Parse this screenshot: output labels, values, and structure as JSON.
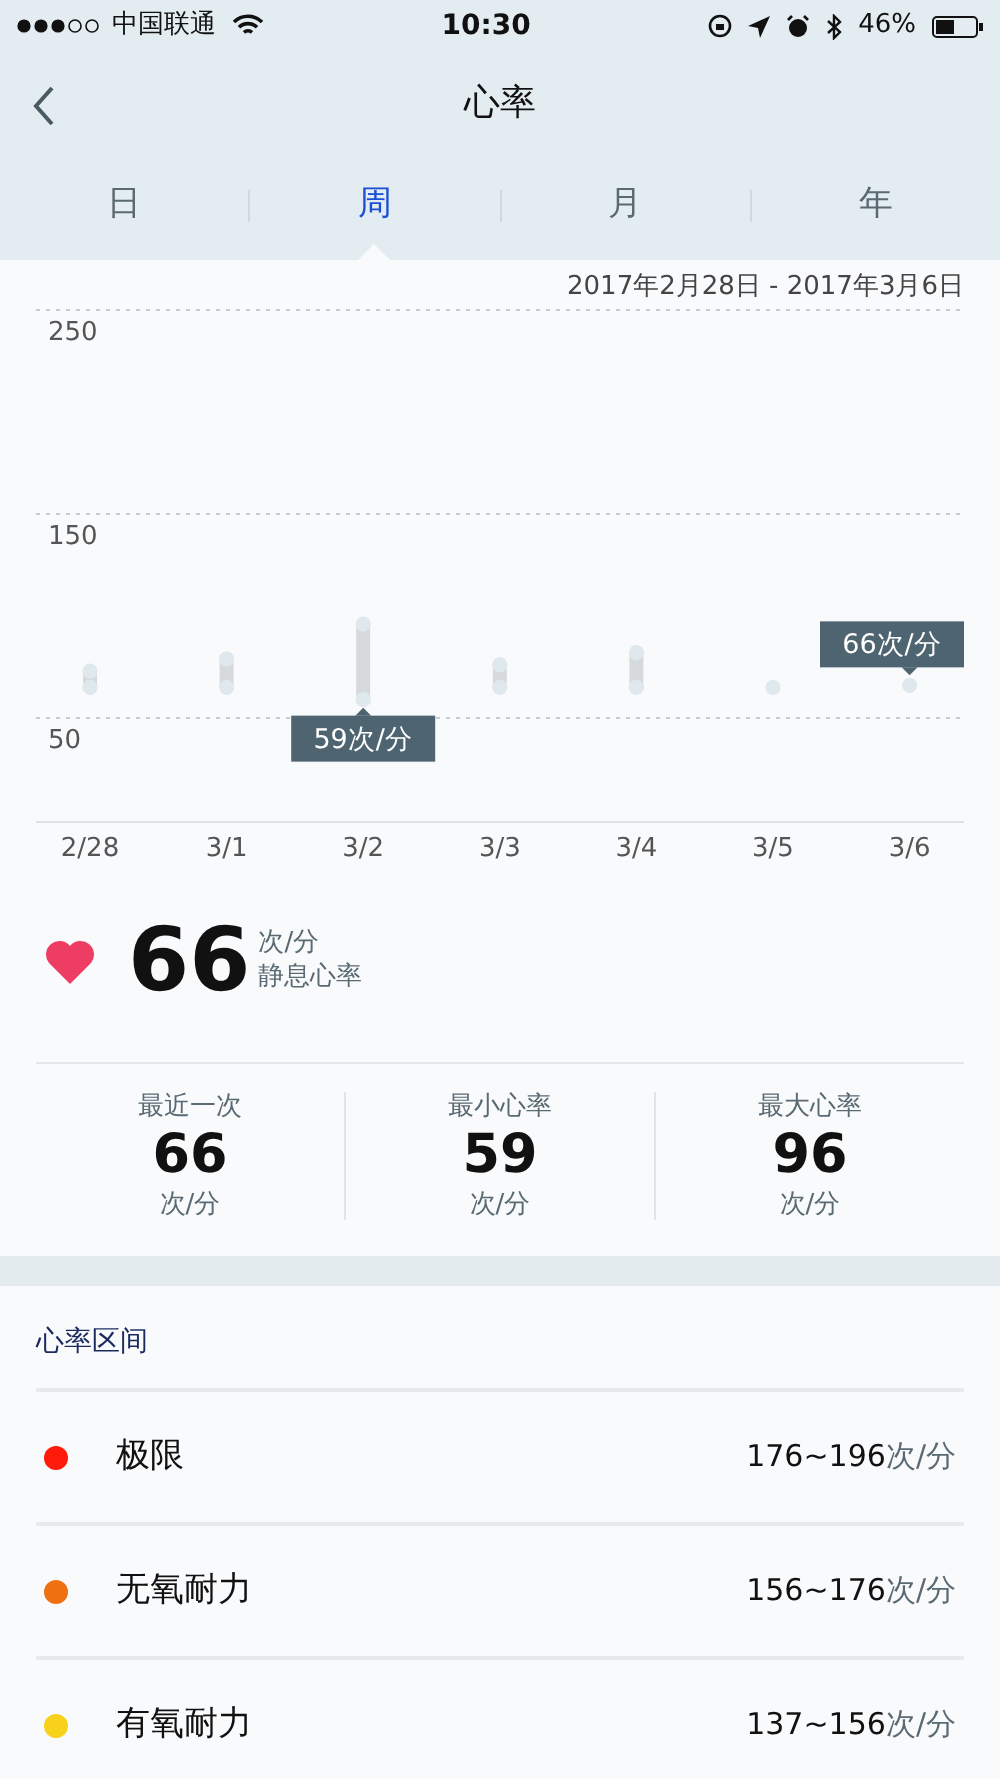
{
  "status_bar": {
    "carrier": "中国联通",
    "time": "10:30",
    "battery": "46%"
  },
  "nav": {
    "title": "心率"
  },
  "tabs": [
    {
      "label": "日",
      "selected": false
    },
    {
      "label": "周",
      "selected": true
    },
    {
      "label": "月",
      "selected": false
    },
    {
      "label": "年",
      "selected": false
    }
  ],
  "date_range": "2017年2月28日 - 2017年3月6日",
  "chart_data": {
    "type": "scatter",
    "categories": [
      "2/28",
      "3/1",
      "3/2",
      "3/3",
      "3/4",
      "3/5",
      "3/6"
    ],
    "series": [
      {
        "color": "#dfe8ec",
        "values": [
          65,
          65,
          59,
          65,
          65,
          65,
          66
        ]
      },
      {
        "color": "#dfe8ec",
        "values": [
          73,
          79,
          96,
          76,
          82,
          null,
          null
        ]
      }
    ],
    "ylim": [
      0,
      250
    ],
    "yticks": [
      50,
      150,
      250
    ],
    "annotations": [
      {
        "x": "3/2",
        "y": 59,
        "text": "59次/分"
      },
      {
        "x": "3/6",
        "y": 66,
        "text": "66次/分"
      }
    ]
  },
  "resting": {
    "value": "66",
    "unit": "次/分",
    "label": "静息心率"
  },
  "stats": [
    {
      "label": "最近一次",
      "value": "66",
      "unit": "次/分"
    },
    {
      "label": "最小心率",
      "value": "59",
      "unit": "次/分"
    },
    {
      "label": "最大心率",
      "value": "96",
      "unit": "次/分"
    }
  ],
  "zones": {
    "title": "心率区间",
    "items": [
      {
        "name": "极限",
        "range": "176~196",
        "unit": "次/分",
        "color": "#ff1a0a"
      },
      {
        "name": "无氧耐力",
        "range": "156~176",
        "unit": "次/分",
        "color": "#ee7011"
      },
      {
        "name": "有氧耐力",
        "range": "137~156",
        "unit": "次/分",
        "color": "#f7d11a"
      }
    ]
  }
}
